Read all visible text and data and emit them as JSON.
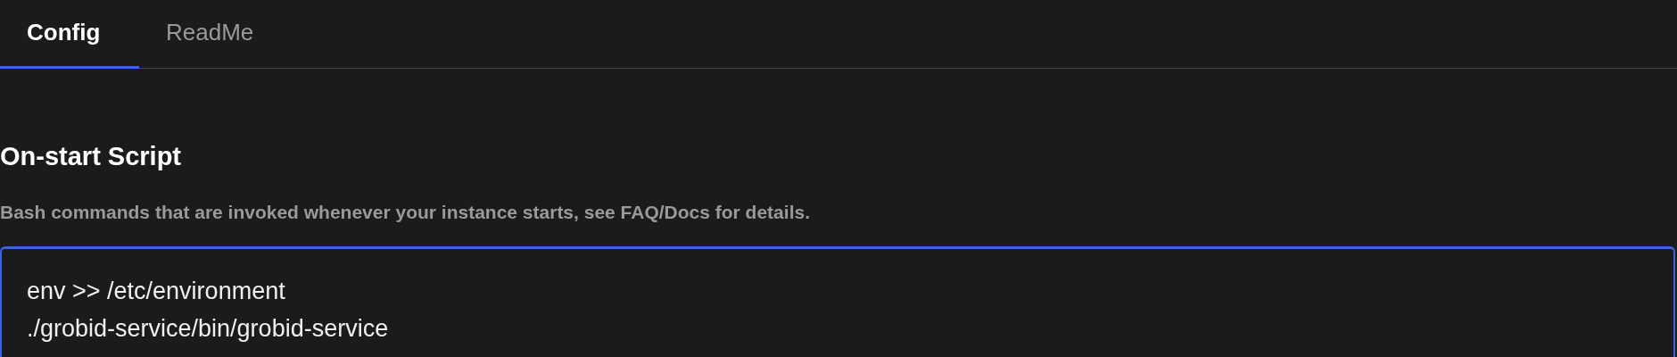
{
  "tabs": [
    {
      "label": "Config",
      "selected": true
    },
    {
      "label": "ReadMe",
      "selected": false
    }
  ],
  "section": {
    "title": "On-start Script",
    "description": "Bash commands that are invoked whenever your instance starts, see FAQ/Docs for details.",
    "script": {
      "focused": true,
      "lines": [
        "env >> /etc/environment",
        "./grobid-service/bin/grobid-service"
      ]
    }
  }
}
